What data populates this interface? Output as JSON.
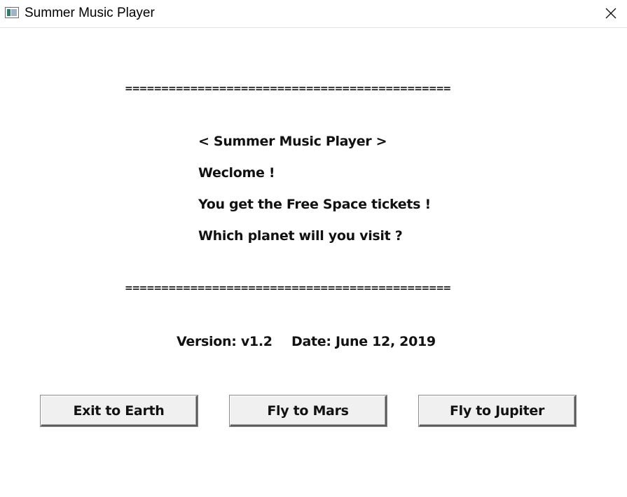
{
  "window": {
    "title": "Summer Music Player",
    "icon": "app-window-icon",
    "close_icon": "close-icon"
  },
  "content": {
    "rule_top": "=============================================",
    "rule_bottom": "=============================================",
    "messages": [
      "< Summer Music Player >",
      "Weclome !",
      "You get the Free Space tickets !",
      "Which planet will you visit ?"
    ],
    "version": "Version: v1.2",
    "date": "Date: June 12, 2019"
  },
  "buttons": {
    "exit": "Exit to Earth",
    "mars": "Fly to Mars",
    "jupiter": "Fly to Jupiter"
  }
}
